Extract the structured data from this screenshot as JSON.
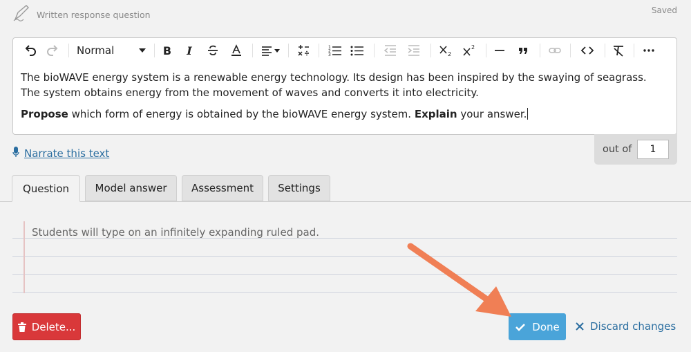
{
  "header": {
    "title": "Written response question",
    "status": "Saved"
  },
  "toolbar": {
    "format": "Normal"
  },
  "editor": {
    "paragraph1": "The bioWAVE energy system is a renewable energy technology. Its design has been inspired by the swaying of seagrass. The system obtains energy from the movement of waves and converts it into electricity.",
    "p2_bold1": "Propose",
    "p2_text1": " which form of energy is obtained by the bioWAVE energy system. ",
    "p2_bold2": "Explain",
    "p2_text2": " your answer."
  },
  "narrate": {
    "label": "Narrate this text"
  },
  "marks": {
    "label": "out of",
    "value": "1"
  },
  "tabs": [
    {
      "label": "Question",
      "active": true
    },
    {
      "label": "Model answer",
      "active": false
    },
    {
      "label": "Assessment",
      "active": false
    },
    {
      "label": "Settings",
      "active": false
    }
  ],
  "pad": {
    "hint": "Students will type on an infinitely expanding ruled pad."
  },
  "actions": {
    "delete_label": "Delete...",
    "done_label": "Done",
    "discard_label": "Discard changes"
  },
  "colors": {
    "danger": "#d9383a",
    "primary": "#4aa4d9",
    "link": "#2b6ea0",
    "arrow": "#f07f55"
  }
}
